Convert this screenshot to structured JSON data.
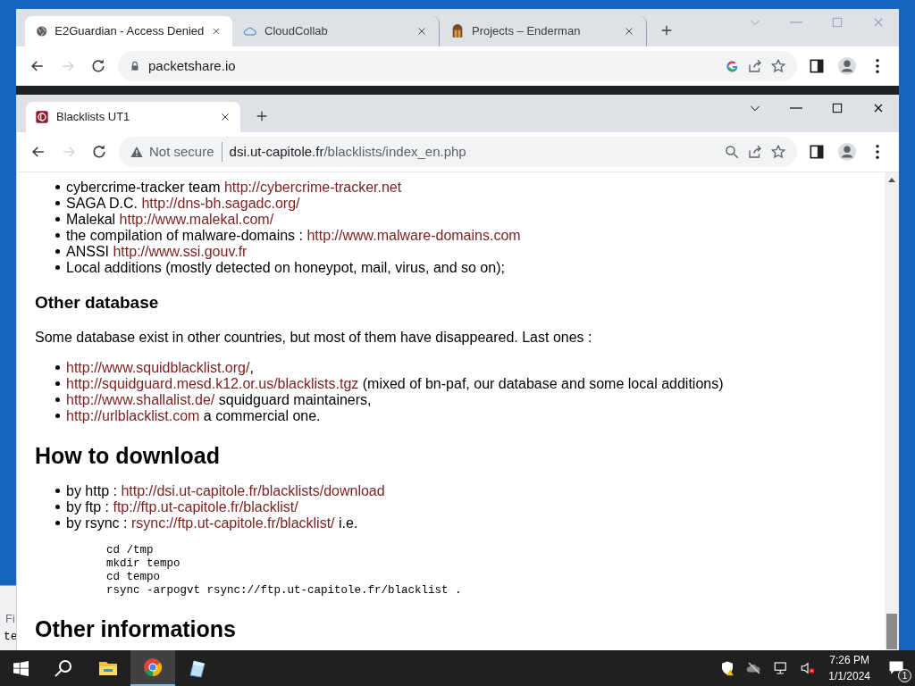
{
  "behind_window": {
    "texts": [
      "Fi",
      "te"
    ]
  },
  "back_window": {
    "tabs": [
      {
        "title": "E2Guardian - Access Denied",
        "selected": true
      },
      {
        "title": "CloudCollab",
        "selected": false
      },
      {
        "title": "Projects – Enderman",
        "selected": false
      }
    ],
    "address": "packetshare.io"
  },
  "front_window": {
    "tabs": [
      {
        "title": "Blacklists UT1",
        "selected": true
      }
    ],
    "security": "Not secure",
    "address_host": "dsi.ut-capitole.fr",
    "address_path": "/blacklists/index_en.php"
  },
  "content": [
    {
      "kind": "list",
      "items": [
        [
          {
            "text": "cybercrime-tracker team "
          },
          {
            "link": "http://cybercrime-tracker.net"
          }
        ],
        [
          {
            "text": "SAGA D.C. "
          },
          {
            "link": "http://dns-bh.sagadc.org/"
          }
        ],
        [
          {
            "text": "Malekal "
          },
          {
            "link": "http://www.malekal.com/"
          }
        ],
        [
          {
            "text": "the compilation of malware-domains : "
          },
          {
            "link": "http://www.malware-domains.com"
          }
        ],
        [
          {
            "text": "ANSSI "
          },
          {
            "link": "http://www.ssi.gouv.fr"
          }
        ],
        [
          {
            "text": "Local additions (mostly detected on honeypot, mail, virus, and so on);"
          }
        ]
      ]
    },
    {
      "kind": "h3",
      "text": "Other database"
    },
    {
      "kind": "paragraph",
      "text": "Some database exist in other countries, but most of them have disappeared. Last ones :"
    },
    {
      "kind": "list",
      "items": [
        [
          {
            "link": "http://www.squidblacklist.org/"
          },
          {
            "text": ","
          }
        ],
        [
          {
            "link": "http://squidguard.mesd.k12.or.us/blacklists.tgz"
          },
          {
            "text": " (mixed of bn-paf, our database and some local additions)"
          }
        ],
        [
          {
            "link": "http://www.shallalist.de/"
          },
          {
            "text": " squidguard maintainers,"
          }
        ],
        [
          {
            "link": "http://urlblacklist.com"
          },
          {
            "text": " a commercial one."
          }
        ]
      ]
    },
    {
      "kind": "h2",
      "text": "How to download"
    },
    {
      "kind": "list",
      "items": [
        [
          {
            "text": "by http : "
          },
          {
            "link": "http://dsi.ut-capitole.fr/blacklists/download"
          }
        ],
        [
          {
            "text": "by ftp : "
          },
          {
            "link": "ftp://ftp.ut-capitole.fr/blacklist/"
          }
        ],
        [
          {
            "text": "by rsync : "
          },
          {
            "link": "rsync://ftp.ut-capitole.fr/blacklist/"
          },
          {
            "text": " i.e."
          }
        ]
      ]
    },
    {
      "kind": "code",
      "lines": [
        "cd /tmp",
        "mkdir tempo",
        "cd tempo",
        "rsync -arpogvt rsync://ftp.ut-capitole.fr/blacklist ."
      ]
    },
    {
      "kind": "h2",
      "text": "Other informations"
    }
  ],
  "taskbar": {
    "time": "7:26 PM",
    "date": "1/1/2024",
    "notifications": "1"
  }
}
